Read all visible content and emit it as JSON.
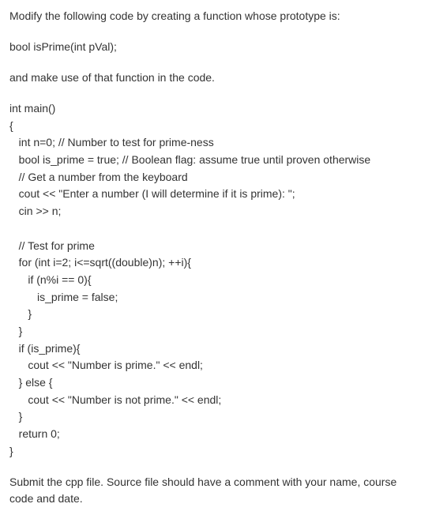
{
  "intro": "Modify the following code by creating a function whose prototype is:",
  "proto": "bool isPrime(int pVal);",
  "instruction": "and make use of that function in the code.",
  "code": "int main()\n{\n   int n=0; // Number to test for prime-ness\n   bool is_prime = true; // Boolean flag: assume true until proven otherwise\n   // Get a number from the keyboard\n   cout << \"Enter a number (I will determine if it is prime): \";\n   cin >> n;\n\n   // Test for prime\n   for (int i=2; i<=sqrt((double)n); ++i){\n      if (n%i == 0){\n         is_prime = false;\n      }\n   }\n   if (is_prime){\n      cout << \"Number is prime.\" << endl;\n   } else {\n      cout << \"Number is not prime.\" << endl;\n   }\n   return 0;\n}",
  "submit": "Submit the cpp file. Source file should have a comment with your name, course code and date."
}
